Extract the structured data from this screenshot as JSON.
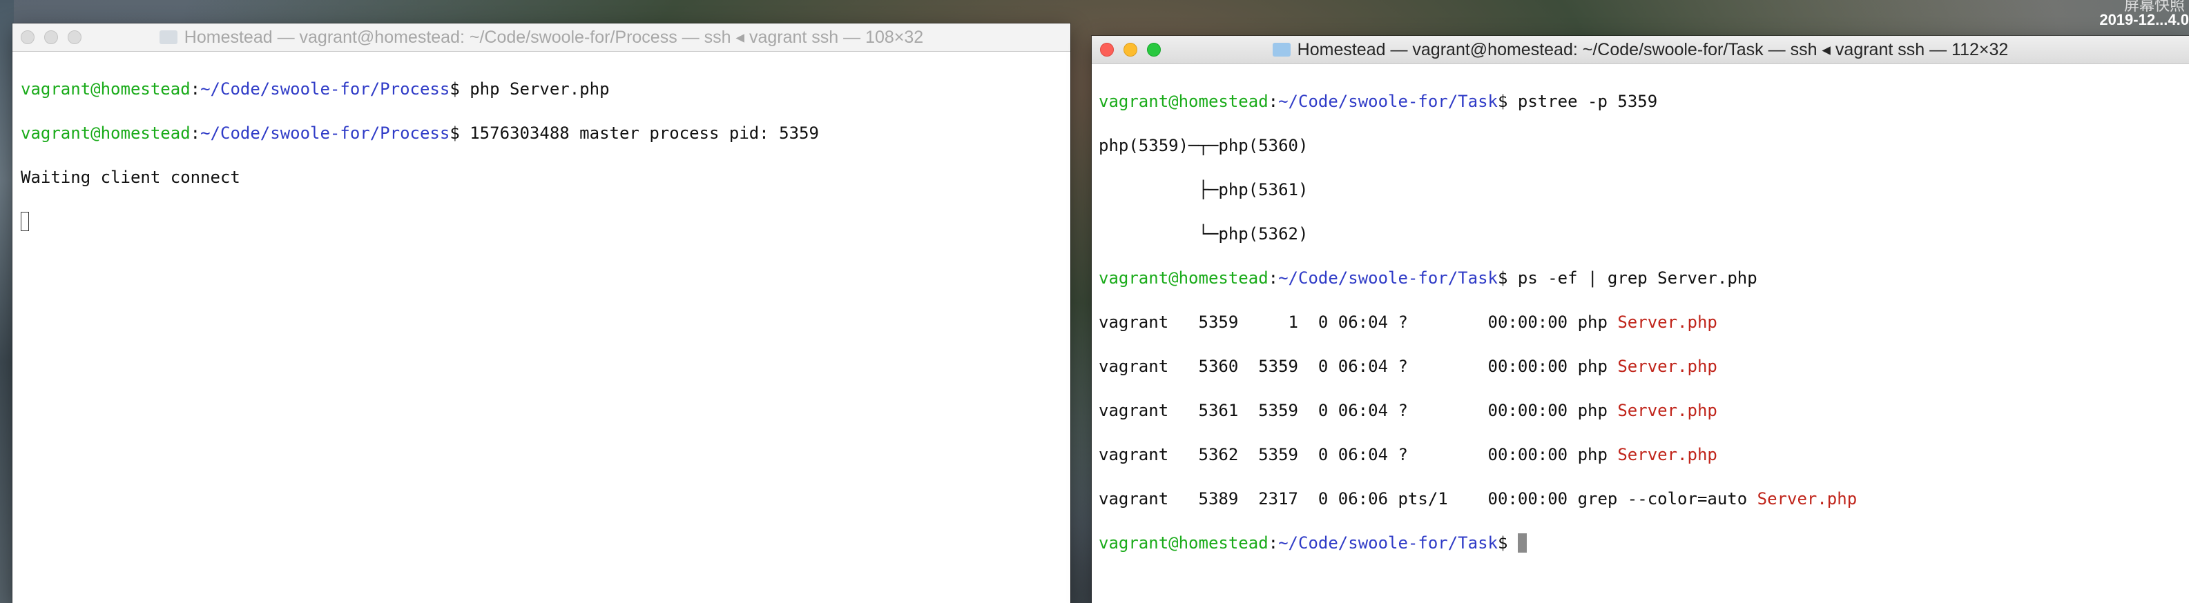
{
  "menubar": {
    "clock_top": "屏幕快照",
    "clock_bottom": "2019-12...4.0"
  },
  "left_window": {
    "title": "Homestead — vagrant@homestead: ~/Code/swoole-for/Process — ssh ◂ vagrant ssh — 108×32",
    "lines": [
      {
        "user": "vagrant@homestead",
        "path": "~/Code/swoole-for/Process",
        "cmd": "$ php Server.php"
      },
      {
        "user": "vagrant@homestead",
        "path": "~/Code/swoole-for/Process",
        "cmd": "$ 1576303488 master process pid: 5359"
      },
      {
        "plain": "Waiting client connect"
      }
    ]
  },
  "right_window": {
    "title": "Homestead — vagrant@homestead: ~/Code/swoole-for/Task — ssh ◂ vagrant ssh — 112×32",
    "prompt1": {
      "user": "vagrant@homestead",
      "path": "~/Code/swoole-for/Task",
      "cmd": "$ pstree -p 5359"
    },
    "pstree": [
      "php(5359)─┬─php(5360)",
      "          ├─php(5361)",
      "          └─php(5362)"
    ],
    "prompt2": {
      "user": "vagrant@homestead",
      "path": "~/Code/swoole-for/Task",
      "cmd": "$ ps -ef | grep Server.php"
    },
    "ps_rows": [
      {
        "prefix": "vagrant   5359     1  0 06:04 ?        00:00:00 php ",
        "match": "Server.php"
      },
      {
        "prefix": "vagrant   5360  5359  0 06:04 ?        00:00:00 php ",
        "match": "Server.php"
      },
      {
        "prefix": "vagrant   5361  5359  0 06:04 ?        00:00:00 php ",
        "match": "Server.php"
      },
      {
        "prefix": "vagrant   5362  5359  0 06:04 ?        00:00:00 php ",
        "match": "Server.php"
      },
      {
        "prefix": "vagrant   5389  2317  0 06:06 pts/1    00:00:00 grep --color=auto ",
        "match": "Server.php"
      }
    ],
    "prompt3": {
      "user": "vagrant@homestead",
      "path": "~/Code/swoole-for/Task",
      "cmd": "$ "
    }
  },
  "colors": {
    "user": "#1aab1a",
    "path": "#2f3bc7",
    "grep_match": "#c0241a"
  },
  "icons": {
    "traffic_lights": [
      "close-button",
      "minimize-button",
      "zoom-button"
    ],
    "folder": "folder-icon"
  }
}
